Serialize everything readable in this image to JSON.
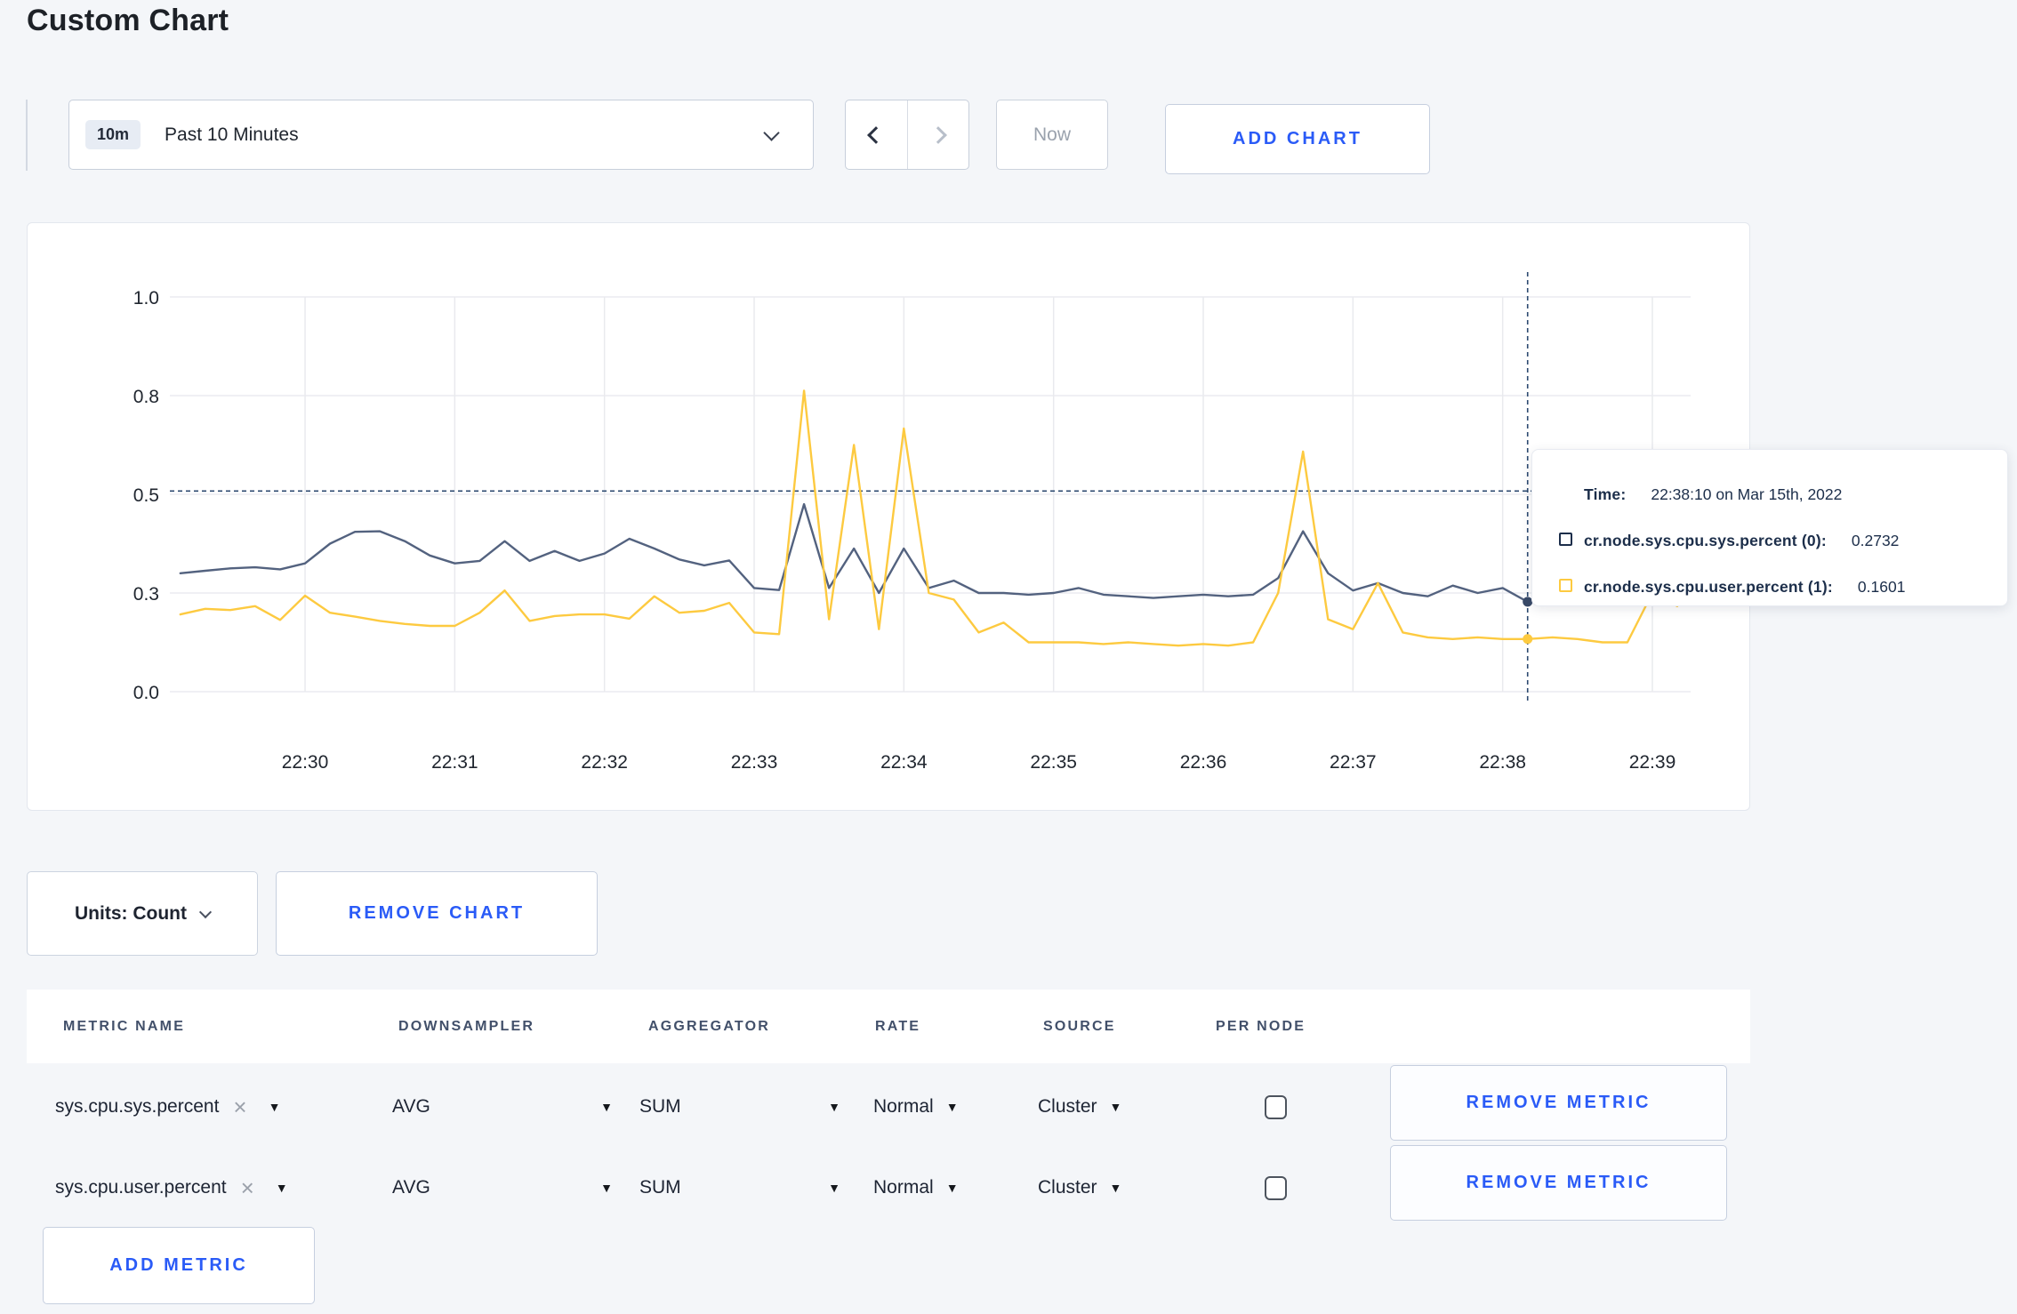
{
  "page": {
    "title": "Custom Chart"
  },
  "colors": {
    "accent_blue": "#2a5bf7",
    "series_sys_line": "#53627f",
    "series_user_line": "#fdca40",
    "tooltip_navy": "#1c2e4a",
    "page_background": "#f4f6f9"
  },
  "toolbar": {
    "time_range_badge": "10m",
    "time_range_label": "Past 10 Minutes",
    "dropdown_icon": "chevron-down-icon",
    "prev_icon": "chevron-left-icon",
    "next_icon": "chevron-right-icon",
    "now_label": "Now",
    "add_chart_label": "ADD CHART"
  },
  "chart_data": {
    "type": "line",
    "title": "",
    "xlabel": "",
    "ylabel": "",
    "grid": true,
    "legend_position": "none",
    "ylim": [
      0.0,
      1.0
    ],
    "y_tick_labels": [
      "0.0",
      "0.3",
      "0.5",
      "0.8",
      "1.0"
    ],
    "y_tick_values": [
      0,
      0.3,
      0.5,
      0.8,
      1.0
    ],
    "x_tick_labels": [
      "22:30",
      "22:31",
      "22:32",
      "22:33",
      "22:34",
      "22:35",
      "22:36",
      "22:37",
      "22:38",
      "22:39"
    ],
    "x_start_time": "22:29:10",
    "x_end_time": "22:39:10",
    "sample_interval_seconds": 10,
    "series": [
      {
        "name": "cr.node.sys.cpu.sys.percent",
        "color": "#53627f",
        "dot_color": "#394a68",
        "values": [
          0.34,
          0.345,
          0.35,
          0.352,
          0.348,
          0.36,
          0.4,
          0.424,
          0.425,
          0.405,
          0.376,
          0.36,
          0.365,
          0.405,
          0.365,
          0.385,
          0.365,
          0.38,
          0.41,
          0.39,
          0.368,
          0.356,
          0.366,
          0.31,
          0.306,
          0.48,
          0.31,
          0.39,
          0.3,
          0.39,
          0.31,
          0.325,
          0.3,
          0.3,
          0.295,
          0.3,
          0.31,
          0.295,
          0.29,
          0.285,
          0.29,
          0.295,
          0.29,
          0.295,
          0.33,
          0.425,
          0.34,
          0.305,
          0.32,
          0.3,
          0.29,
          0.315,
          0.3,
          0.31,
          0.2732,
          0.31,
          0.33,
          0.31,
          0.295,
          0.31,
          0.305
        ]
      },
      {
        "name": "cr.node.sys.cpu.user.percent",
        "color": "#fdca40",
        "dot_color": "#fdca40",
        "values": [
          0.235,
          0.252,
          0.248,
          0.26,
          0.218,
          0.292,
          0.24,
          0.228,
          0.215,
          0.206,
          0.2,
          0.2,
          0.24,
          0.305,
          0.215,
          0.23,
          0.235,
          0.235,
          0.222,
          0.29,
          0.24,
          0.246,
          0.27,
          0.18,
          0.175,
          0.81,
          0.22,
          0.65,
          0.19,
          0.7,
          0.3,
          0.28,
          0.18,
          0.21,
          0.15,
          0.15,
          0.15,
          0.145,
          0.15,
          0.145,
          0.14,
          0.145,
          0.14,
          0.15,
          0.3,
          0.63,
          0.22,
          0.19,
          0.32,
          0.18,
          0.165,
          0.16,
          0.165,
          0.16,
          0.1601,
          0.165,
          0.16,
          0.15,
          0.15,
          0.3,
          0.26
        ]
      }
    ],
    "crosshair": {
      "time": "22:38:10",
      "time_index": 54,
      "y_value": 0.51
    },
    "tooltip": {
      "time_label": "Time:",
      "time_value": "22:38:10 on Mar 15th, 2022",
      "rows": [
        {
          "name": "cr.node.sys.cpu.sys.percent (0):",
          "value": "0.2732",
          "swatch_color": "#1c2e4a"
        },
        {
          "name": "cr.node.sys.cpu.user.percent (1):",
          "value": "0.1601",
          "swatch_color": "#fdca40"
        }
      ]
    }
  },
  "units_bar": {
    "units_label": "Units: Count",
    "remove_chart_label": "REMOVE CHART"
  },
  "metrics_table": {
    "headers": [
      "METRIC NAME",
      "DOWNSAMPLER",
      "AGGREGATOR",
      "RATE",
      "SOURCE",
      "PER NODE"
    ],
    "dropdown_icon": "▼",
    "remove_icon": "×",
    "rows": [
      {
        "metric_name": "sys.cpu.sys.percent",
        "downsampler": "AVG",
        "aggregator": "SUM",
        "rate": "Normal",
        "source": "Cluster",
        "per_node_checked": false,
        "remove_label": "REMOVE METRIC"
      },
      {
        "metric_name": "sys.cpu.user.percent",
        "downsampler": "AVG",
        "aggregator": "SUM",
        "rate": "Normal",
        "source": "Cluster",
        "per_node_checked": false,
        "remove_label": "REMOVE METRIC"
      }
    ],
    "add_metric_label": "ADD METRIC"
  }
}
